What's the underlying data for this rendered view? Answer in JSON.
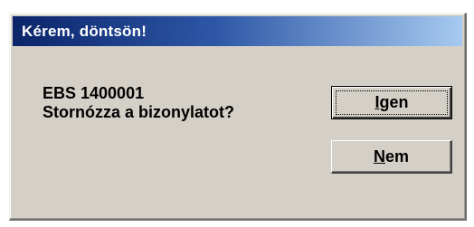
{
  "dialog": {
    "title": "Kérem, döntsön!",
    "message_line1": "EBS 1400001",
    "message_line2": "Stornózza a bizonylatot?"
  },
  "buttons": {
    "yes": {
      "accel": "I",
      "rest": "gen"
    },
    "no": {
      "accel": "N",
      "rest": "em"
    }
  }
}
